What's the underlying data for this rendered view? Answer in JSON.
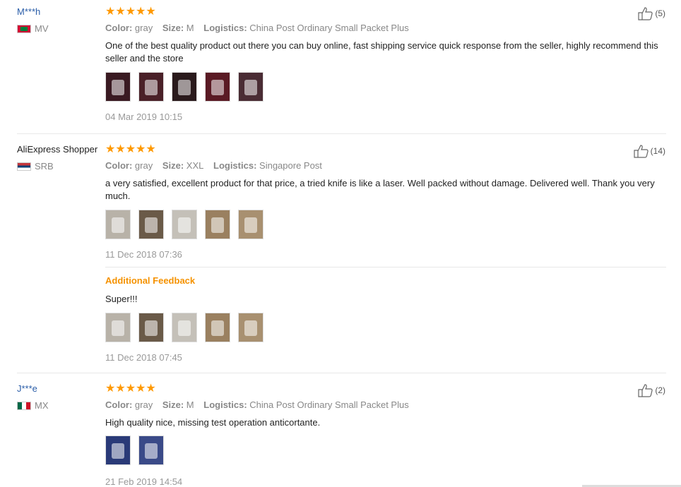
{
  "labels": {
    "color": "Color:",
    "size": "Size:",
    "logistics": "Logistics:",
    "additional_feedback": "Additional Feedback"
  },
  "stars": "★★★★★",
  "reviews": [
    {
      "user": "M***h",
      "country": "MV",
      "color": "gray",
      "size": "M",
      "logistics": "China Post Ordinary Small Packet Plus",
      "text": "One of the best quality product out there you can buy online, fast shipping service quick response from the seller, highly recommend this seller and the store",
      "photo_colors": [
        "#3a1a22",
        "#4a2028",
        "#2a1a1c",
        "#5a1a24",
        "#4a2c34"
      ],
      "date": "04 Mar 2019 10:15",
      "likes": "(5)"
    },
    {
      "user": "AliExpress Shopper",
      "country": "SRB",
      "color": "gray",
      "size": "XXL",
      "logistics": "Singapore Post",
      "text": "a very satisfied, excellent product for that price, a tried knife is like a laser. Well packed without damage. Delivered well. Thank you very much.",
      "photo_colors": [
        "#b8b2a8",
        "#6a5a48",
        "#c4c0b8",
        "#9a8060",
        "#a89070"
      ],
      "date": "11 Dec 2018 07:36",
      "likes": "(14)",
      "additional_text": "Super!!!",
      "additional_photo_colors": [
        "#b8b2a8",
        "#6a5a48",
        "#c4c0b8",
        "#9a8060",
        "#a89070"
      ],
      "additional_date": "11 Dec 2018 07:45"
    },
    {
      "user": "J***e",
      "country": "MX",
      "color": "gray",
      "size": "M",
      "logistics": "China Post Ordinary Small Packet Plus",
      "text": "High quality nice, missing test operation anticortante.",
      "photo_colors": [
        "#2a3a78",
        "#3a4a88"
      ],
      "date": "21 Feb 2019 14:54",
      "likes": "(2)"
    }
  ]
}
